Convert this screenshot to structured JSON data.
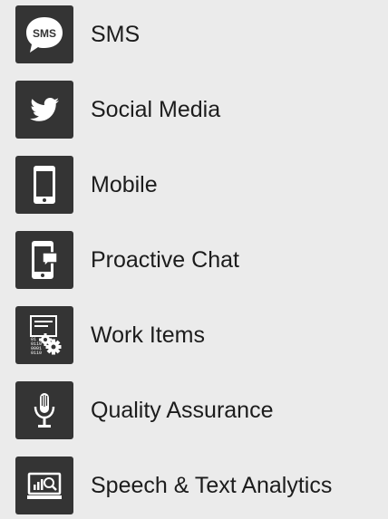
{
  "items": [
    {
      "label": "SMS",
      "icon": "sms-bubble-icon",
      "badge": "SMS"
    },
    {
      "label": "Social Media",
      "icon": "twitter-bird-icon"
    },
    {
      "label": "Mobile",
      "icon": "smartphone-icon"
    },
    {
      "label": "Proactive Chat",
      "icon": "phone-chat-icon"
    },
    {
      "label": "Work Items",
      "icon": "work-items-gears-icon",
      "binary_text": [
        "01",
        "0110",
        "0001",
        "0110"
      ]
    },
    {
      "label": "Quality Assurance",
      "icon": "microphone-icon"
    },
    {
      "label": "Speech & Text Analytics",
      "icon": "analytics-monitor-icon"
    }
  ],
  "colors": {
    "background": "#ebebeb",
    "tile": "#343434",
    "icon": "#ffffff",
    "text": "#1c1c1c"
  }
}
